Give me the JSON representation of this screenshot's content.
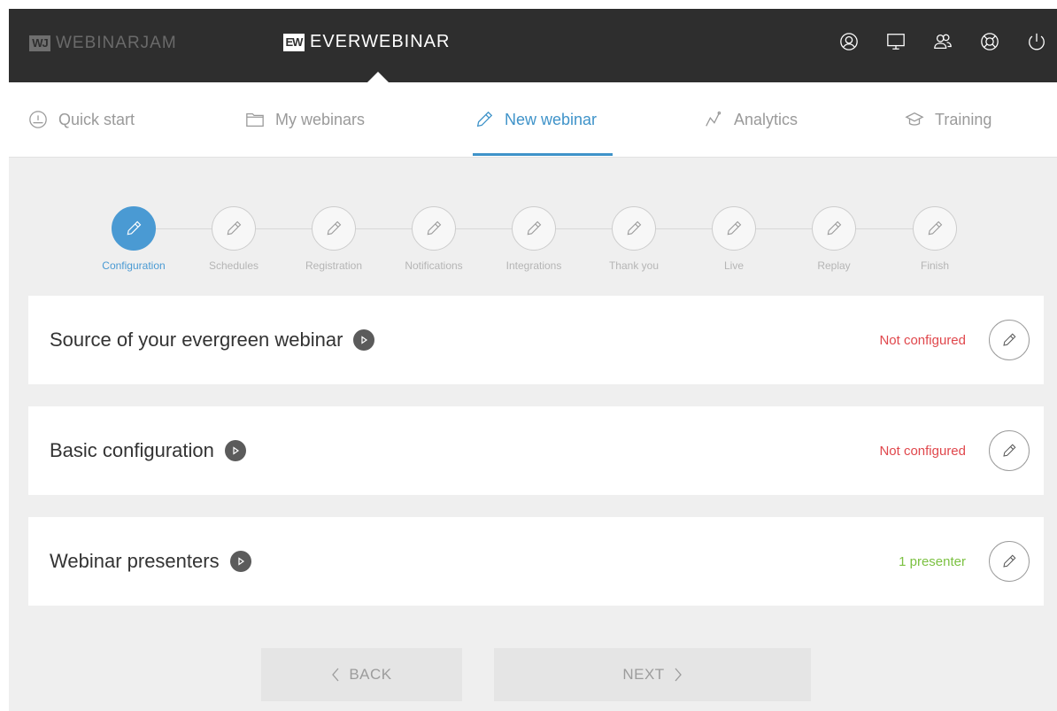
{
  "topbar": {
    "brand_left": {
      "logo": "WJ",
      "name": "WEBINARJAM"
    },
    "brand_right": {
      "logo": "EW",
      "name": "EVERWEBINAR"
    },
    "icons": [
      "user-icon",
      "monitor-icon",
      "users-icon",
      "support-icon",
      "power-icon"
    ]
  },
  "nav": {
    "items": [
      {
        "label": "Quick start",
        "icon": "speedometer-icon"
      },
      {
        "label": "My webinars",
        "icon": "folder-icon"
      },
      {
        "label": "New webinar",
        "icon": "pencil-icon",
        "active": true
      },
      {
        "label": "Analytics",
        "icon": "chart-line-icon"
      },
      {
        "label": "Training",
        "icon": "graduation-cap-icon"
      }
    ]
  },
  "steps": [
    {
      "label": "Configuration",
      "active": true
    },
    {
      "label": "Schedules"
    },
    {
      "label": "Registration"
    },
    {
      "label": "Notifications"
    },
    {
      "label": "Integrations"
    },
    {
      "label": "Thank you"
    },
    {
      "label": "Live"
    },
    {
      "label": "Replay"
    },
    {
      "label": "Finish"
    }
  ],
  "cards": [
    {
      "title": "Source of your evergreen webinar",
      "status": "Not configured",
      "status_color": "#e0474c"
    },
    {
      "title": "Basic configuration",
      "status": "Not configured",
      "status_color": "#e0474c"
    },
    {
      "title": "Webinar presenters",
      "status": "1 presenter",
      "status_color": "#7cc142"
    }
  ],
  "buttons": {
    "back": "BACK",
    "next": "NEXT"
  },
  "colors": {
    "accent": "#4a9ad3",
    "topbar": "#2e2e2e",
    "background": "#efefef"
  }
}
